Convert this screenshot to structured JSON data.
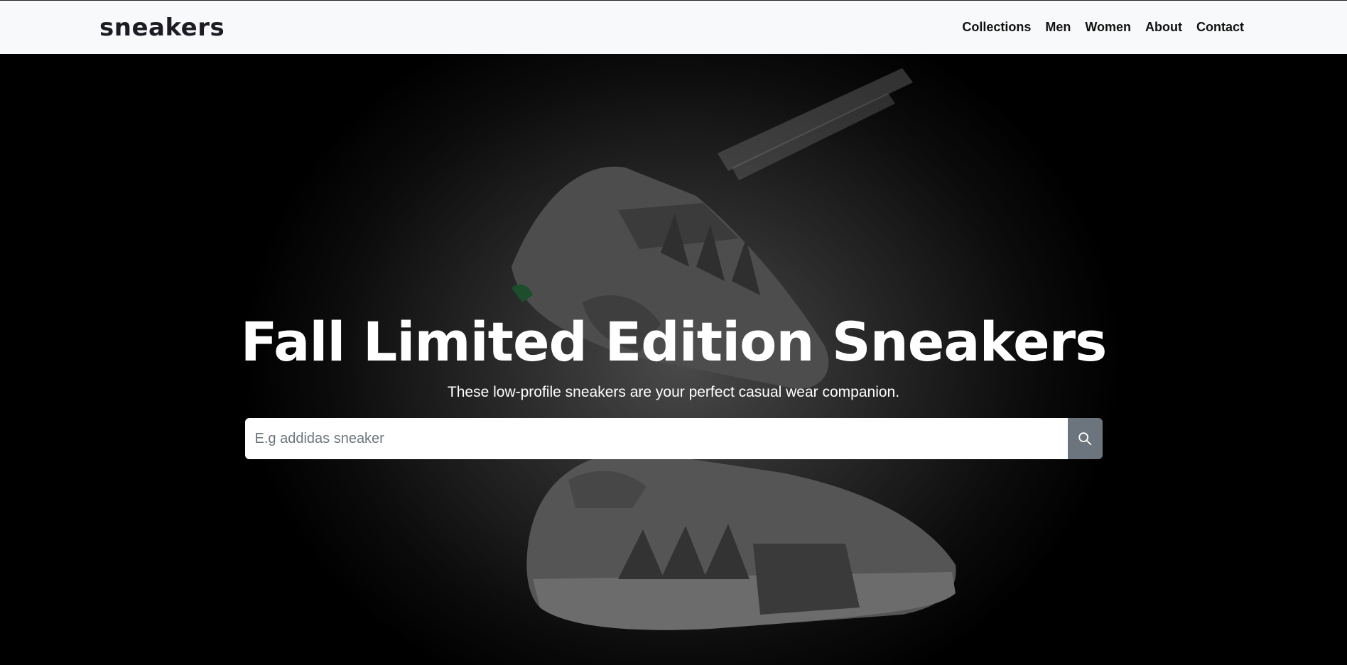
{
  "brand": {
    "logo_text": "sneakers"
  },
  "nav": {
    "links": [
      {
        "label": "Collections"
      },
      {
        "label": "Men"
      },
      {
        "label": "Women"
      },
      {
        "label": "About"
      },
      {
        "label": "Contact"
      }
    ]
  },
  "hero": {
    "title": "Fall Limited Edition Sneakers",
    "subtitle": "These low-profile sneakers are your perfect casual wear companion.",
    "search": {
      "placeholder": "E.g addidas sneaker",
      "value": "",
      "button_icon": "search-icon"
    }
  },
  "colors": {
    "navbar_bg": "#f8f9fa",
    "hero_bg": "#000000",
    "search_button_bg": "#6c757d",
    "text_light": "#ffffff",
    "text_dark": "#111111"
  }
}
